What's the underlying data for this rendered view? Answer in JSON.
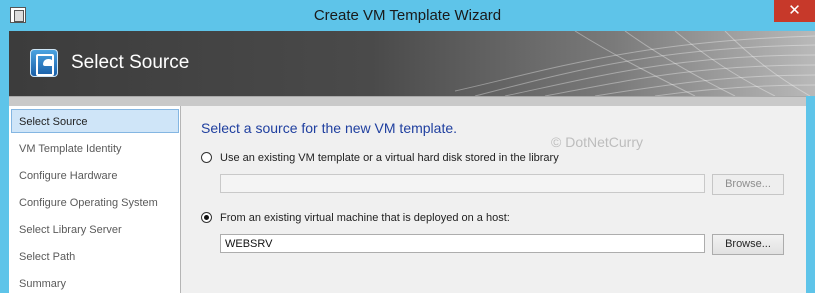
{
  "window": {
    "title": "Create VM Template Wizard",
    "close_label": "✕"
  },
  "banner": {
    "title": "Select Source"
  },
  "nav": {
    "items": [
      {
        "label": "Select Source",
        "active": true
      },
      {
        "label": "VM Template Identity",
        "active": false
      },
      {
        "label": "Configure Hardware",
        "active": false
      },
      {
        "label": "Configure Operating System",
        "active": false
      },
      {
        "label": "Select Library Server",
        "active": false
      },
      {
        "label": "Select Path",
        "active": false
      },
      {
        "label": "Summary",
        "active": false
      }
    ]
  },
  "main": {
    "heading": "Select a source for the new VM template.",
    "watermark": "© DotNetCurry",
    "option_library": {
      "label": "Use an existing VM template or a virtual hard disk stored in the library",
      "selected": false,
      "field_value": "",
      "browse_label": "Browse..."
    },
    "option_host": {
      "label": "From an existing virtual machine that is deployed on a host:",
      "selected": true,
      "field_value": "WEBSRV",
      "browse_label": "Browse..."
    }
  },
  "colors": {
    "window_frame": "#5ec4e9",
    "close_button": "#c7392a",
    "heading_text": "#1f3f9f",
    "nav_selected": "#cfe5f8"
  }
}
